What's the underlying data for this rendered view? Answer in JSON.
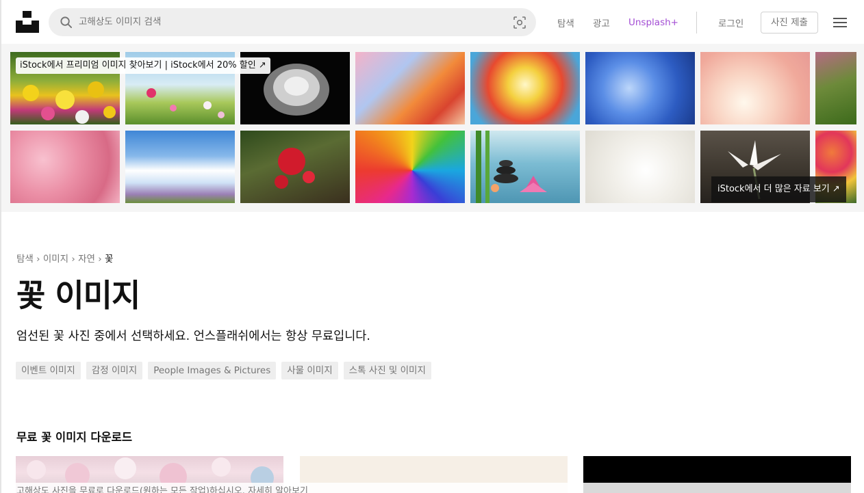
{
  "header": {
    "search_placeholder": "고해상도 이미지 검색",
    "nav": {
      "explore": "탐색",
      "advertise": "광고",
      "plus": "Unsplash+",
      "login": "로그인",
      "submit": "사진 제출"
    }
  },
  "banner": {
    "promo_badge": "iStock에서 프리미엄 이미지 찾아보기 | iStock에서 20% 할인 ↗",
    "more_badge": "iStock에서 더 많은 자료 보기 ↗"
  },
  "breadcrumb": [
    "탐색",
    "이미지",
    "자연",
    "꽃"
  ],
  "breadcrumb_sep": "›",
  "page_title": "꽃 이미지",
  "description": "엄선된 꽃 사진 중에서 선택하세요. 언스플래쉬에서는 항상 무료입니다.",
  "tags": [
    "이벤트 이미지",
    "감정 이미지",
    "People Images & Pictures",
    "사물 이미지",
    "스톡 사진 및 이미지"
  ],
  "section_title": "무료 꽃 이미지 다운로드",
  "footer_note": "고해상도 사진을 무료로 다운로드(원하는 모든 작업)하십시오. 자세히 알아보기",
  "colors": {
    "accent_plus": "#a34dd4",
    "muted_text": "#767676",
    "search_bg": "#eeeeee",
    "banner_bg": "#f5f5f5"
  }
}
